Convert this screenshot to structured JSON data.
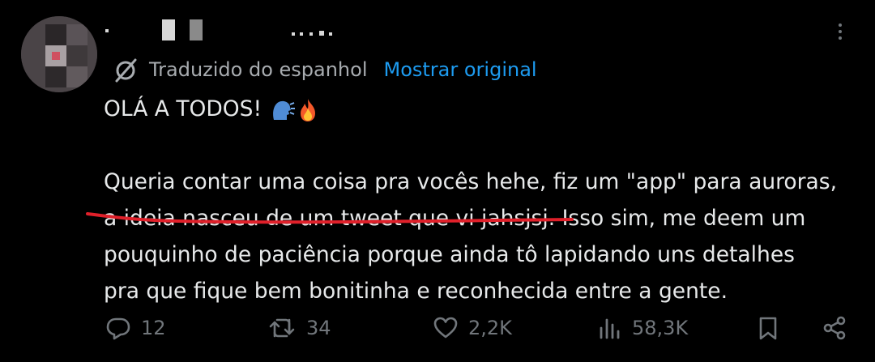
{
  "tweet": {
    "translation_label": "Traduzido do espanhol",
    "show_original": "Mostrar original",
    "line_greeting": "OLÁ A TODOS!",
    "line1": "Queria contar uma coisa pra vocês hehe, fiz um \"app\" para auroras,",
    "line2_underlined": "a ideia nasceu de um tweet que vi jahsjsj.",
    "line2_rest": " Isso sim, me deem um",
    "line3": "pouquinho de paciência porque ainda tô lapidando uns detalhes",
    "line4": "pra que fique bem bonitinha e reconhecida entre a gente."
  },
  "actions": {
    "replies": "12",
    "retweets": "34",
    "likes": "2,2K",
    "views": "58,3K"
  },
  "icons": {
    "translate": "globe-slash-icon",
    "reply": "reply-bubble-icon",
    "retweet": "retweet-icon",
    "like": "heart-icon",
    "views": "bar-chart-icon",
    "bookmark": "bookmark-icon",
    "share": "share-icon",
    "more": "more-dots-icon",
    "emoji1": "speaking-head-emoji",
    "emoji2": "fire-emoji"
  },
  "colors": {
    "accent": "#1d9bf0",
    "text": "#e7e9ea",
    "muted": "#71767b",
    "annotation": "#e0202a"
  }
}
